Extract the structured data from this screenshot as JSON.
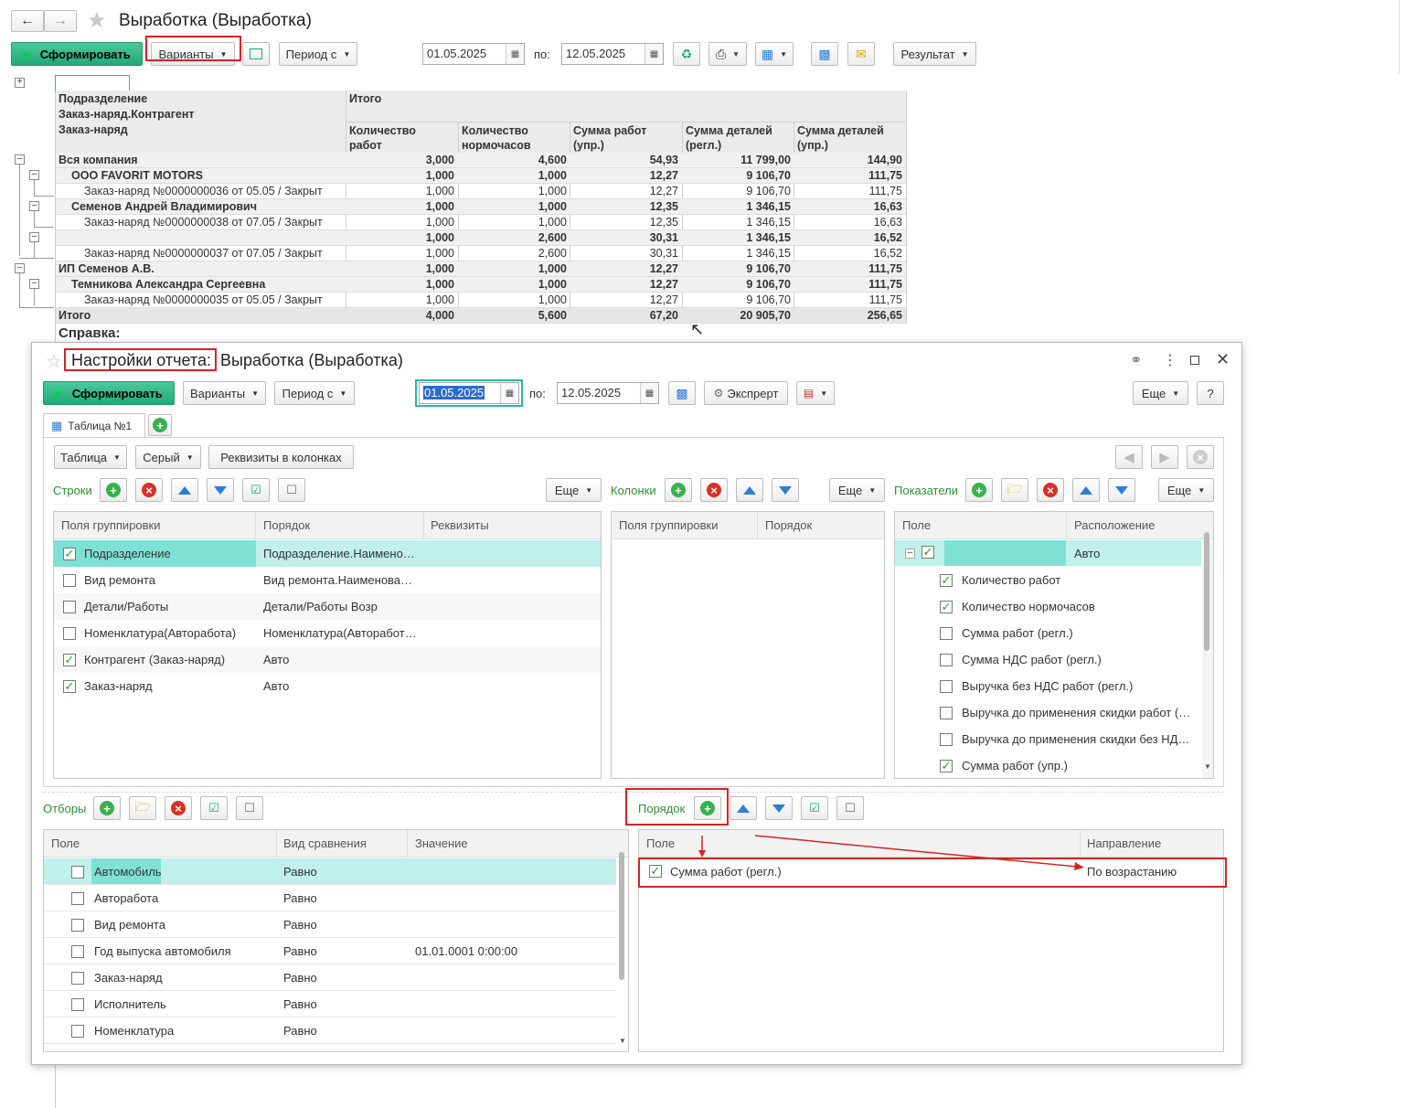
{
  "window": {
    "title": "Выработка (Выработка)",
    "toolbar": {
      "generate": "Сформировать",
      "variants": "Варианты",
      "period": "Период с",
      "date_from": "01.05.2025",
      "to_label": "по:",
      "date_to": "12.05.2025",
      "result": "Результат"
    }
  },
  "report": {
    "headers": {
      "g1": "Подразделение",
      "g2": "Заказ-наряд.Контрагент",
      "g3": "Заказ-наряд",
      "total": "Итого",
      "c1": "Количество работ",
      "c2": "Количество нормочасов",
      "c3": "Сумма работ (упр.)",
      "c4": "Сумма деталей (регл.)",
      "c5": "Сумма деталей (упр.)"
    },
    "rows": [
      {
        "label": "Вся компания",
        "v1": "3,000",
        "v2": "4,600",
        "v3": "54,93",
        "v4": "11 799,00",
        "v5": "144,90"
      },
      {
        "label": "ООО FAVORIT MOTORS",
        "v1": "1,000",
        "v2": "1,000",
        "v3": "12,27",
        "v4": "9 106,70",
        "v5": "111,75"
      },
      {
        "label": "Заказ-наряд №0000000036  от 05.05 / Закрыт",
        "v1": "1,000",
        "v2": "1,000",
        "v3": "12,27",
        "v4": "9 106,70",
        "v5": "111,75"
      },
      {
        "label": "Семенов Андрей Владимирович",
        "v1": "1,000",
        "v2": "1,000",
        "v3": "12,35",
        "v4": "1 346,15",
        "v5": "16,63"
      },
      {
        "label": "Заказ-наряд №0000000038  от 07.05 / Закрыт",
        "v1": "1,000",
        "v2": "1,000",
        "v3": "12,35",
        "v4": "1 346,15",
        "v5": "16,63"
      },
      {
        "label": "",
        "v1": "1,000",
        "v2": "2,600",
        "v3": "30,31",
        "v4": "1 346,15",
        "v5": "16,52"
      },
      {
        "label": "Заказ-наряд №0000000037  от 07.05 / Закрыт",
        "v1": "1,000",
        "v2": "2,600",
        "v3": "30,31",
        "v4": "1 346,15",
        "v5": "16,52"
      },
      {
        "label": "ИП Семенов А.В.",
        "v1": "1,000",
        "v2": "1,000",
        "v3": "12,27",
        "v4": "9 106,70",
        "v5": "111,75"
      },
      {
        "label": "Темникова Александра Сергеевна",
        "v1": "1,000",
        "v2": "1,000",
        "v3": "12,27",
        "v4": "9 106,70",
        "v5": "111,75"
      },
      {
        "label": "Заказ-наряд №0000000035  от 05.05 / Закрыт",
        "v1": "1,000",
        "v2": "1,000",
        "v3": "12,27",
        "v4": "9 106,70",
        "v5": "111,75"
      },
      {
        "label": "Итого",
        "v1": "4,000",
        "v2": "5,600",
        "v3": "67,20",
        "v4": "20 905,70",
        "v5": "256,65"
      }
    ],
    "footnote": "Справка:"
  },
  "dialog": {
    "title_prefix": "Настройки отчета:",
    "title_rest": " Выработка (Выработка)",
    "toolbar": {
      "generate": "Сформировать",
      "variants": "Варианты",
      "period": "Период с",
      "date_from": "01.05.2025",
      "to_label": "по:",
      "date_to": "12.05.2025",
      "expert": "Экспрерт",
      "more": "Еще",
      "help": "?"
    },
    "tab": "Таблица №1",
    "subtoolbar": {
      "table": "Таблица",
      "gray": "Серый",
      "attrs": "Реквизиты в колонках"
    },
    "rows_section": {
      "label": "Строки",
      "more": "Еще",
      "headers": [
        "Поля группировки",
        "Порядок",
        "Реквизиты"
      ],
      "items": [
        {
          "name": "Подразделение",
          "order": "Подразделение.Наимено…",
          "checked": true
        },
        {
          "name": "Вид ремонта",
          "order": "Вид ремонта.Наименова…",
          "checked": false
        },
        {
          "name": "Детали/Работы",
          "order": "Детали/Работы Возр",
          "checked": false
        },
        {
          "name": "Номенклатура(Авторабота)",
          "order": "Номенклатура(Авторабот…",
          "checked": false
        },
        {
          "name": "Контрагент (Заказ-наряд)",
          "order": "Авто",
          "checked": true
        },
        {
          "name": "Заказ-наряд",
          "order": "Авто",
          "checked": true
        }
      ]
    },
    "cols_section": {
      "label": "Колонки",
      "more": "Еще",
      "headers": [
        "Поля группировки",
        "Порядок"
      ]
    },
    "ind_section": {
      "label": "Показатели",
      "more": "Еще",
      "headers": [
        "Поле",
        "Расположение"
      ],
      "root_value": "Авто",
      "items": [
        {
          "name": "Количество работ",
          "checked": true
        },
        {
          "name": "Количество нормочасов",
          "checked": true
        },
        {
          "name": "Сумма работ (регл.)",
          "checked": false
        },
        {
          "name": "Сумма НДС работ (регл.)",
          "checked": false
        },
        {
          "name": "Выручка без НДС работ (регл.)",
          "checked": false
        },
        {
          "name": "Выручка до применения скидки работ (…",
          "checked": false
        },
        {
          "name": "Выручка до применения скидки без НД…",
          "checked": false
        },
        {
          "name": "Сумма работ (упр.)",
          "checked": true
        }
      ]
    },
    "filters": {
      "label": "Отборы",
      "headers": [
        "Поле",
        "Вид сравнения",
        "Значение"
      ],
      "items": [
        {
          "field": "Автомобиль",
          "cmp": "Равно",
          "value": ""
        },
        {
          "field": "Авторабота",
          "cmp": "Равно",
          "value": ""
        },
        {
          "field": "Вид ремонта",
          "cmp": "Равно",
          "value": ""
        },
        {
          "field": "Год выпуска автомобиля",
          "cmp": "Равно",
          "value": "01.01.0001 0:00:00"
        },
        {
          "field": "Заказ-наряд",
          "cmp": "Равно",
          "value": ""
        },
        {
          "field": "Исполнитель",
          "cmp": "Равно",
          "value": ""
        },
        {
          "field": "Номенклатура",
          "cmp": "Равно",
          "value": ""
        }
      ]
    },
    "order": {
      "label": "Порядок",
      "headers": [
        "Поле",
        "Направление"
      ],
      "items": [
        {
          "field": "Сумма работ (регл.)",
          "dir": "По возрастанию",
          "checked": true
        }
      ]
    }
  },
  "colors": {
    "accent_green": "#22a978",
    "selection": "#bff0ea",
    "highlight_red": "#d42424",
    "section_green": "#2f8f2f"
  }
}
